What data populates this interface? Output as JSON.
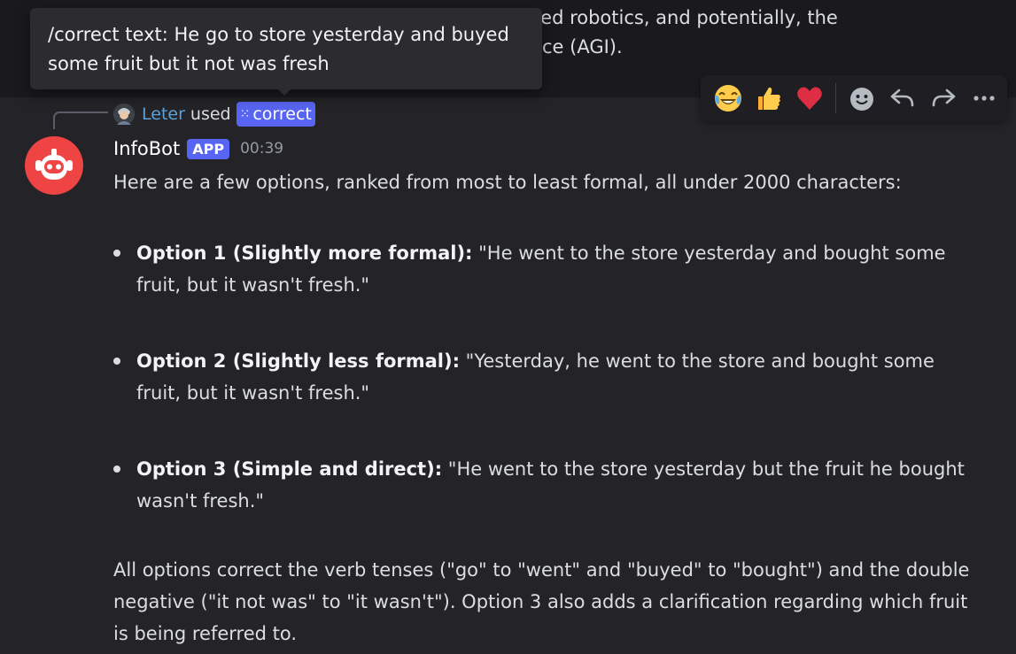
{
  "previous_message": {
    "line1": "vanced robotics, and potentially, the",
    "line2": "ce (AGI)."
  },
  "tooltip": {
    "text": "/correct text: He go to store yesterday and buyed some fruit but it not was fresh"
  },
  "command_reply": {
    "user": "Leter",
    "used": "used",
    "command": "correct"
  },
  "toolbar": {
    "reactions": [
      "joy-emoji",
      "thumbs-up-emoji",
      "heart-emoji"
    ],
    "actions": [
      "add-reaction-icon",
      "reply-icon",
      "forward-icon",
      "more-icon"
    ]
  },
  "message": {
    "username": "InfoBot",
    "badge": "APP",
    "timestamp": "00:39",
    "intro": "Here are a few options, ranked from most to least formal, all under 2000 characters:",
    "options": [
      {
        "label": "Option 1 (Slightly more formal):",
        "text": " \"He went to the store yesterday and bought some fruit, but it wasn't fresh.\""
      },
      {
        "label": "Option 2 (Slightly less formal):",
        "text": " \"Yesterday, he went to the store and bought some fruit, but it wasn't fresh.\""
      },
      {
        "label": "Option 3 (Simple and direct):",
        "text": " \"He went to the store yesterday but the fruit he bought wasn't fresh.\""
      }
    ],
    "summary": "All options correct the verb tenses (\"go\" to \"went\" and \"buyed\" to \"bought\") and the double negative (\"it not was\" to \"it wasn't\"). Option 3 also adds a clarification regarding which fruit is being referred to."
  },
  "colors": {
    "background": "#242428",
    "tooltip": "#2b2b30",
    "brand": "#5865f2",
    "avatar": "#ef4444",
    "link": "#5da1d9"
  }
}
